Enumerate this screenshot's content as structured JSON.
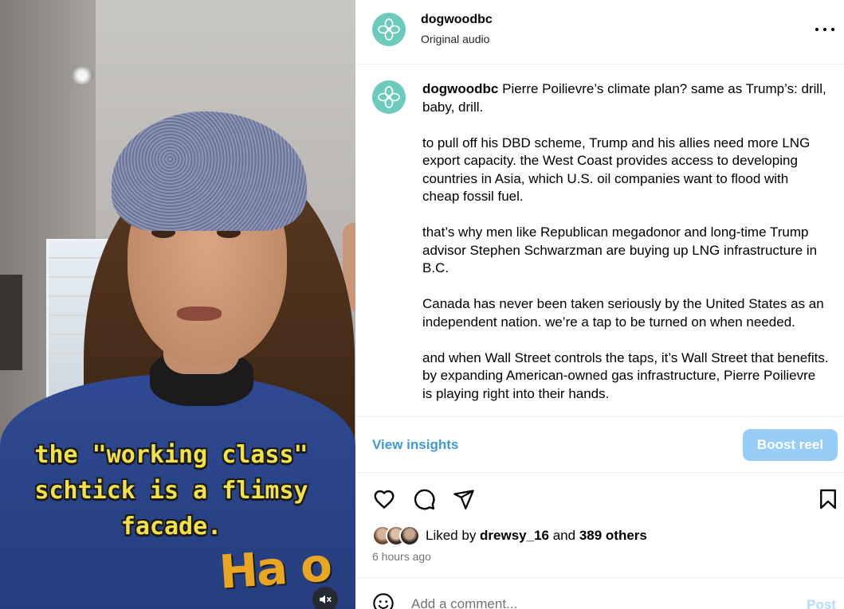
{
  "video": {
    "caption_lines": [
      "the \"working class\"",
      "schtick is a flimsy",
      "facade."
    ],
    "shirt_logo": "Ha o",
    "mute_icon": "speaker-muted-icon"
  },
  "header": {
    "username": "dogwoodbc",
    "audio": "Original audio",
    "more_icon": "more-horizontal-icon"
  },
  "post": {
    "username": "dogwoodbc",
    "first_line": "Pierre Poilievre’s climate plan? same as Trump’s: drill, baby, drill.",
    "paragraphs": [
      "to pull off his DBD scheme, Trump and his allies need more LNG export capacity. the West Coast provides access to developing countries in Asia, which U.S. oil companies want to flood with cheap fossil fuel.",
      "that’s why men like Republican megadonor and long-time Trump advisor Stephen Schwarzman are buying up LNG infrastructure in B.C.",
      "Canada has never been taken seriously by the United States as an independent nation. we’re a tap to be turned on when needed.",
      "and when Wall Street controls the taps, it’s Wall Street that benefits. by expanding American-owned gas infrastructure, Pierre Poilievre is playing right into their hands."
    ]
  },
  "insights": {
    "view_label": "View insights",
    "boost_label": "Boost reel"
  },
  "actions": {
    "like_icon": "heart-icon",
    "comment_icon": "comment-icon",
    "share_icon": "send-icon",
    "save_icon": "bookmark-icon"
  },
  "likes": {
    "prefix": "Liked by ",
    "user": "drewsy_16",
    "middle": " and ",
    "others": "389 others"
  },
  "timestamp": "6 hours ago",
  "comment": {
    "placeholder": "Add a comment...",
    "post_label": "Post",
    "emoji_icon": "smiley-icon"
  },
  "colors": {
    "accent": "#0095f6",
    "link": "#3d9ad9",
    "boost_bg": "#97cdf7",
    "avatar_bg": "#6ccbbd",
    "caption_yellow": "#f3e14a"
  }
}
